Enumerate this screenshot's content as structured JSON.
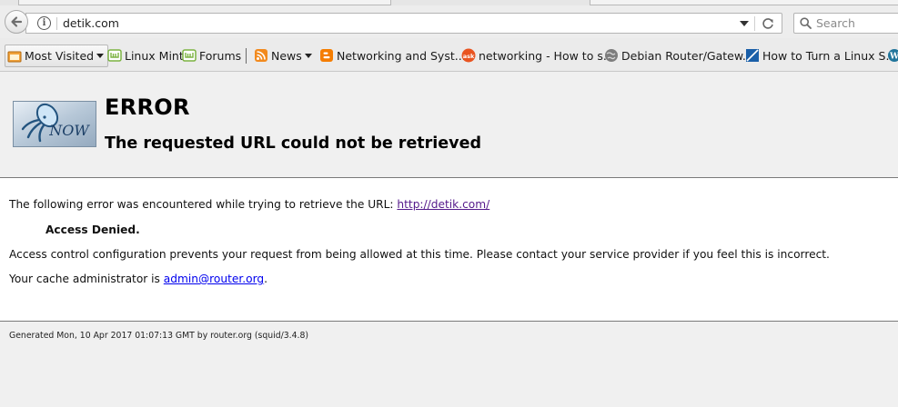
{
  "browser": {
    "url": "detik.com",
    "search_placeholder": "Search"
  },
  "bookmarks": {
    "most_visited": "Most Visited",
    "items": [
      "Linux Mint",
      "Forums",
      "News",
      "Networking and Syst...",
      "networking - How to s...",
      "Debian Router/Gatew...",
      "How to Turn a Linux S..."
    ]
  },
  "page": {
    "logo_text": "NOW",
    "title": "ERROR",
    "subtitle": "The requested URL could not be retrieved",
    "intro": "The following error was encountered while trying to retrieve the URL: ",
    "url_link": "http://detik.com/",
    "access": "Access Denied.",
    "description": "Access control configuration prevents your request from being allowed at this time. Please contact your service provider if you feel this is incorrect.",
    "admin_prefix": "Your cache administrator is ",
    "admin_email": "admin@router.org",
    "admin_suffix": ".",
    "footer": "Generated Mon, 10 Apr 2017 01:07:13 GMT by router.org (squid/3.4.8)"
  },
  "colors": {
    "visited_link": "#551a8b",
    "link": "#0000ee",
    "mint_green": "#8bc34a",
    "rss_orange": "#f28a1e",
    "blogger_orange": "#f57d00",
    "ask_orange": "#e95420"
  }
}
